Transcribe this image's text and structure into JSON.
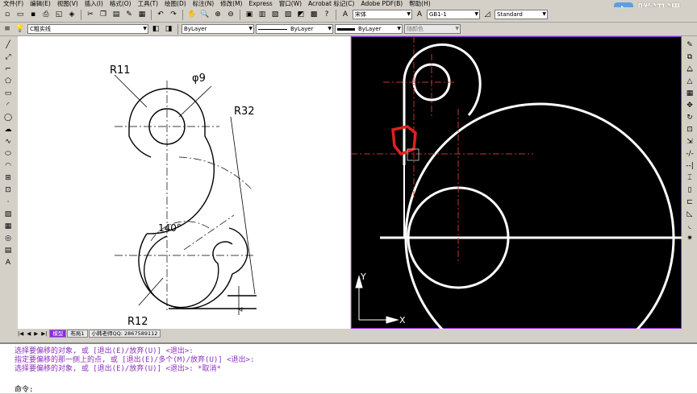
{
  "menu": [
    "文件(F)",
    "编辑(E)",
    "视图(V)",
    "插入(I)",
    "格式(O)",
    "工具(T)",
    "绘图(D)",
    "标注(N)",
    "修改(M)",
    "Express",
    "窗口(W)",
    "Acrobat 标记(C)",
    "Adobe PDF(B)",
    "帮助(H)"
  ],
  "toolbar1": {
    "font_name": "宋体",
    "text_style": "GB1-1",
    "dim_style": "Standard"
  },
  "toolbar2": {
    "layer": "C粗实线",
    "color": "ByLayer",
    "linetype": "ByLayer",
    "lineweight": "ByLayer",
    "plotstyle": "随颜色"
  },
  "drawing_labels": {
    "r11": "R11",
    "phi9": "φ9",
    "r32": "R32",
    "angle140": "140°",
    "r12": "R12",
    "dim4": "4",
    "ucs_y": "Y",
    "ucs_x": "X"
  },
  "tabs": {
    "model": "模型",
    "layout1": "布局1",
    "qq": "小韩老师QQ: 2867589112"
  },
  "command_history": [
    "选择要偏移的对象, 或 [退出(E)/放弃(U)] <退出>:",
    "指定要偏移的那一侧上的点, 或 [退出(E)/多个(M)/放弃(U)] <退出>:",
    "选择要偏移的对象, 或 [退出(E)/放弃(U)] <退出>:  *取消*"
  ],
  "command_prompt": "命令:",
  "watermark": "腾讯课",
  "colors": {
    "accent": "#8a2be2",
    "cmd_text": "#8b2fbf",
    "center_line": "#c0392b"
  }
}
